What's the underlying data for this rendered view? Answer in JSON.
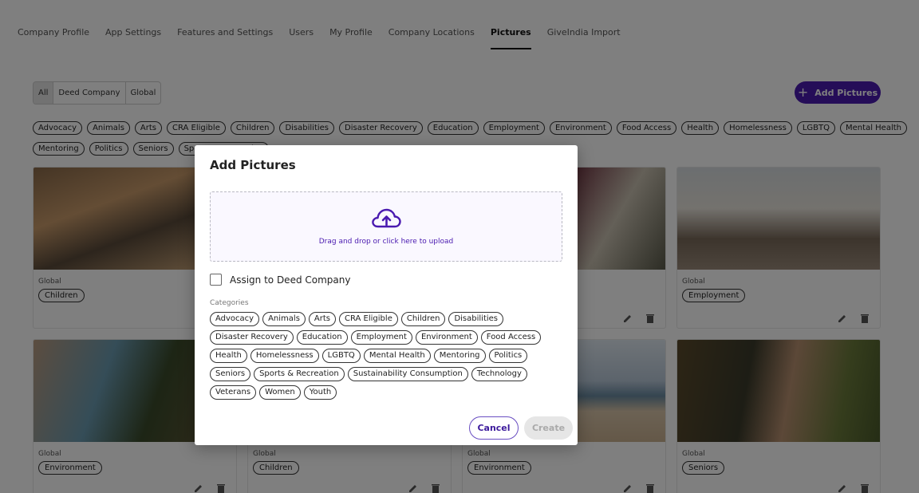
{
  "tabs": [
    {
      "label": "Company Profile"
    },
    {
      "label": "App Settings"
    },
    {
      "label": "Features and Settings"
    },
    {
      "label": "Users"
    },
    {
      "label": "My Profile"
    },
    {
      "label": "Company Locations"
    },
    {
      "label": "Pictures",
      "active": true
    },
    {
      "label": "GiveIndia Import"
    }
  ],
  "filter": {
    "all": "All",
    "deed_company": "Deed Company",
    "global": "Global"
  },
  "add_button": {
    "label": "Add Pictures"
  },
  "category_chips_row1": [
    "Advocacy",
    "Animals",
    "Arts",
    "CRA Eligible",
    "Children",
    "Disabilities",
    "Disaster Recovery",
    "Education",
    "Employment",
    "Environment",
    "Food Access",
    "Health",
    "Homelessness",
    "LGBTQ",
    "Mental Health"
  ],
  "category_chips_row2": [
    "Mentoring",
    "Politics",
    "Seniors",
    "Sports & Recreation"
  ],
  "cards": [
    {
      "scope": "Global",
      "category": "Children"
    },
    {
      "scope": "Global",
      "category": "Employment"
    },
    {
      "scope": "Global",
      "category": "Environment"
    },
    {
      "scope": "Global",
      "category": "Children"
    },
    {
      "scope": "Global",
      "category": "Environment"
    },
    {
      "scope": "Global",
      "category": "Seniors"
    }
  ],
  "modal": {
    "title": "Add Pictures",
    "dropzone_hint": "Drag and drop or click here to upload",
    "assign_label": "Assign to Deed Company",
    "categories_label": "Categories",
    "categories": [
      "Advocacy",
      "Animals",
      "Arts",
      "CRA Eligible",
      "Children",
      "Disabilities",
      "Disaster Recovery",
      "Education",
      "Employment",
      "Environment",
      "Food Access",
      "Health",
      "Homelessness",
      "LGBTQ",
      "Mental Health",
      "Mentoring",
      "Politics",
      "Seniors",
      "Sports & Recreation",
      "Sustainability Consumption",
      "Technology",
      "Veterans",
      "Women",
      "Youth"
    ],
    "cancel_label": "Cancel",
    "create_label": "Create"
  },
  "colors": {
    "accent": "#4a1ab0",
    "overlay": "rgba(0,0,0,0.5)"
  }
}
